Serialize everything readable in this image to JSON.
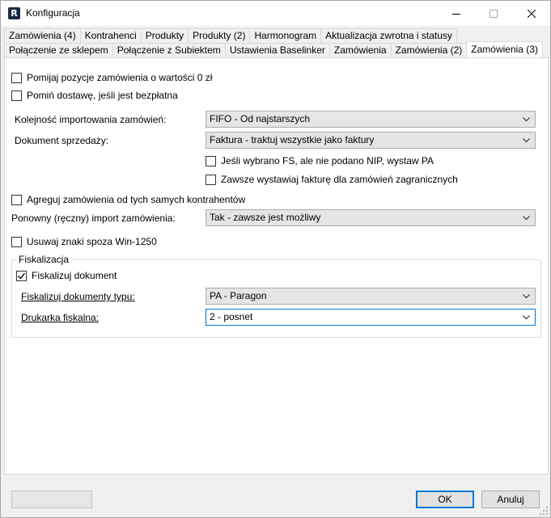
{
  "window": {
    "title": "Konfiguracja",
    "app_icon_letter": "R"
  },
  "tabs_row1": [
    "Zamówienia (4)",
    "Kontrahenci",
    "Produkty",
    "Produkty (2)",
    "Harmonogram",
    "Aktualizacja zwrotna i statusy"
  ],
  "tabs_row2": [
    "Połączenie ze sklepem",
    "Połączenie z Subiektem",
    "Ustawienia Baselinker",
    "Zamówienia",
    "Zamówienia (2)",
    "Zamówienia (3)"
  ],
  "active_tab": "Zamówienia (3)",
  "options": {
    "skip_zero": {
      "label": "Pomijaj pozycje zamówienia o wartości 0 zł",
      "checked": false
    },
    "skip_free_delivery": {
      "label": "Pomiń dostawę, jeśli jest bezpłatna",
      "checked": false
    },
    "import_order": {
      "label": "Kolejność importowania zamówień:",
      "value": "FIFO - Od najstarszych"
    },
    "sales_doc": {
      "label": "Dokument sprzedaży:",
      "value": "Faktura - traktuj wszystkie jako faktury"
    },
    "fs_no_nip": {
      "label": "Jeśli wybrano FS, ale nie podano NIP, wystaw PA",
      "checked": false
    },
    "foreign_invoice": {
      "label": "Zawsze wystawiaj fakturę dla zamówień zagranicznych",
      "checked": false
    },
    "aggregate": {
      "label": "Agreguj zamówienia od tych samych kontrahentów",
      "checked": false
    },
    "reimport": {
      "label": "Ponowny (ręczny) import zamówienia:",
      "value": "Tak - zawsze jest możliwy"
    },
    "remove_chars": {
      "label": "Usuwaj znaki spoza Win-1250",
      "checked": false
    }
  },
  "fiscal": {
    "group_label": "Fiskalizacja",
    "fiscalize": {
      "label": "Fiskalizuj dokument",
      "checked": true
    },
    "doc_types": {
      "label": "Fiskalizuj dokumenty typu:",
      "value": "PA - Paragon"
    },
    "printer": {
      "label": "Drukarka fiskalna:",
      "value": "2 - posnet"
    }
  },
  "buttons": {
    "ok": "OK",
    "cancel": "Anuluj",
    "disabled": ""
  }
}
